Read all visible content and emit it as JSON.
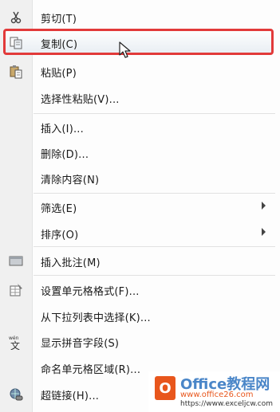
{
  "menu": {
    "items": [
      {
        "label": "剪切(T)",
        "icon": "scissors-icon"
      },
      {
        "label": "复制(C)",
        "icon": "copy-icon"
      },
      {
        "label": "粘贴(P)",
        "icon": "paste-icon"
      },
      {
        "label": "选择性粘贴(V)..."
      },
      {
        "label": "插入(I)..."
      },
      {
        "label": "删除(D)..."
      },
      {
        "label": "清除内容(N)"
      },
      {
        "label": "筛选(E)",
        "submenu": true
      },
      {
        "label": "排序(O)",
        "submenu": true
      },
      {
        "label": "插入批注(M)",
        "icon": "comment-icon"
      },
      {
        "label": "设置单元格格式(F)...",
        "icon": "format-cells-icon"
      },
      {
        "label": "从下拉列表中选择(K)..."
      },
      {
        "label": "显示拼音字段(S)",
        "icon": "phonetic-icon"
      },
      {
        "label": "命名单元格区域(R)..."
      },
      {
        "label": "超链接(H)...",
        "icon": "hyperlink-icon"
      }
    ],
    "highlight_color": "#e23a3a"
  },
  "watermark": {
    "title": "Office教程网",
    "url1": "www.office26.com",
    "url2": "https://www.exceljcw.com"
  }
}
